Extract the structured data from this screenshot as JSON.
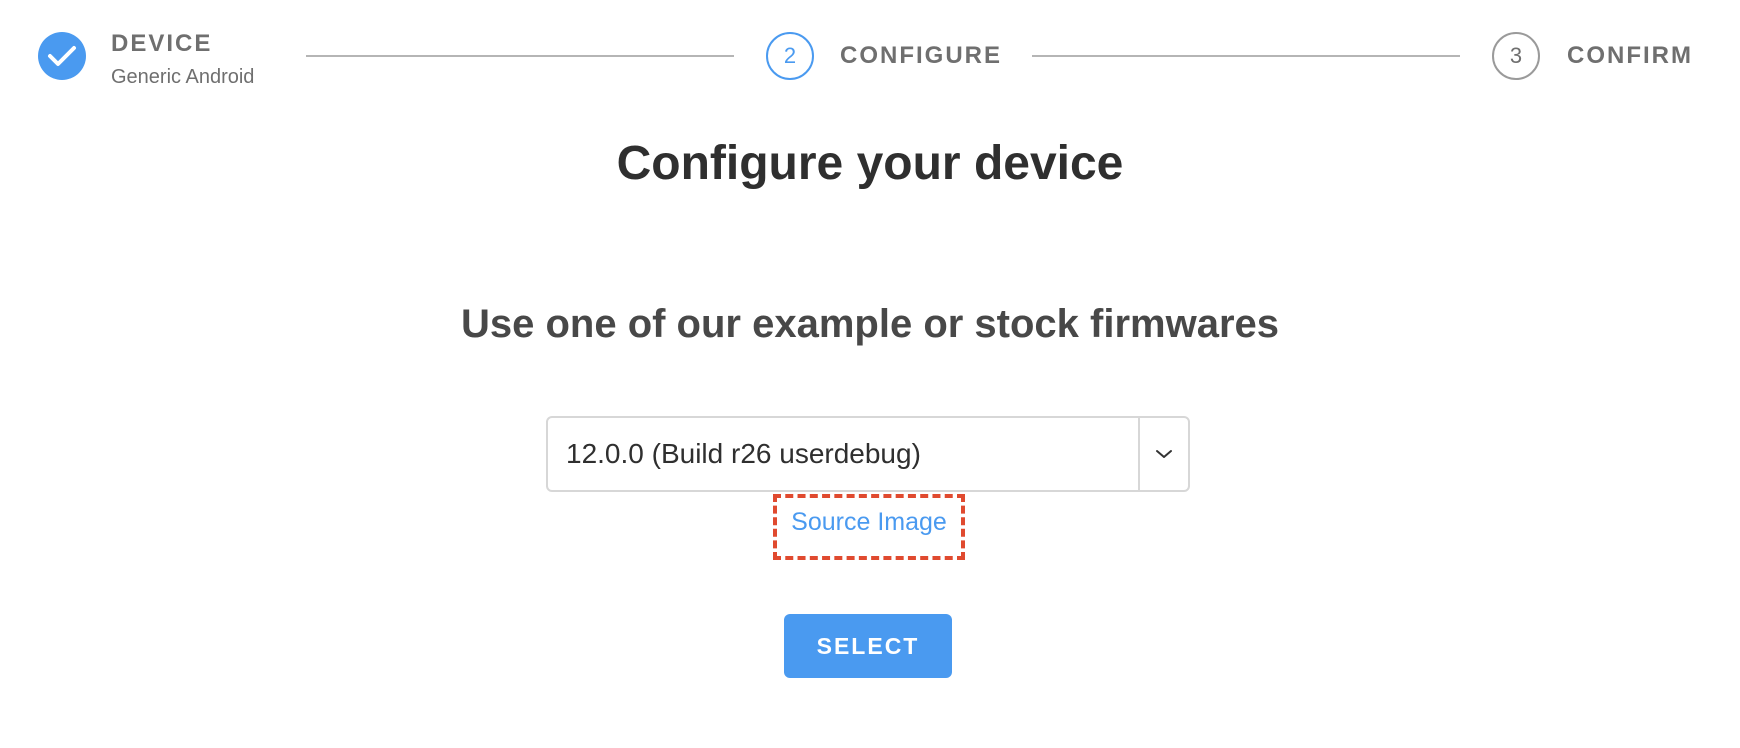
{
  "stepper": {
    "steps": [
      {
        "number": "",
        "title": "DEVICE",
        "subtitle": "Generic Android",
        "state": "completed",
        "icon": "checkmark-icon"
      },
      {
        "number": "2",
        "title": "CONFIGURE",
        "subtitle": "",
        "state": "active"
      },
      {
        "number": "3",
        "title": "CONFIRM",
        "subtitle": "",
        "state": "pending"
      }
    ]
  },
  "main": {
    "title": "Configure your device",
    "section_title": "Use one of our example or stock firmwares",
    "firmware_select": {
      "selected_value": "12.0.0 (Build r26 userdebug)",
      "caret_icon": "chevron-down-icon"
    },
    "source_link": "Source Image",
    "select_button_label": "SELECT"
  },
  "colors": {
    "accent": "#4a9af0",
    "highlight_dashed": "#e04a2f",
    "text_dark": "#2f2f2f",
    "text_muted": "#6f6f6f"
  }
}
